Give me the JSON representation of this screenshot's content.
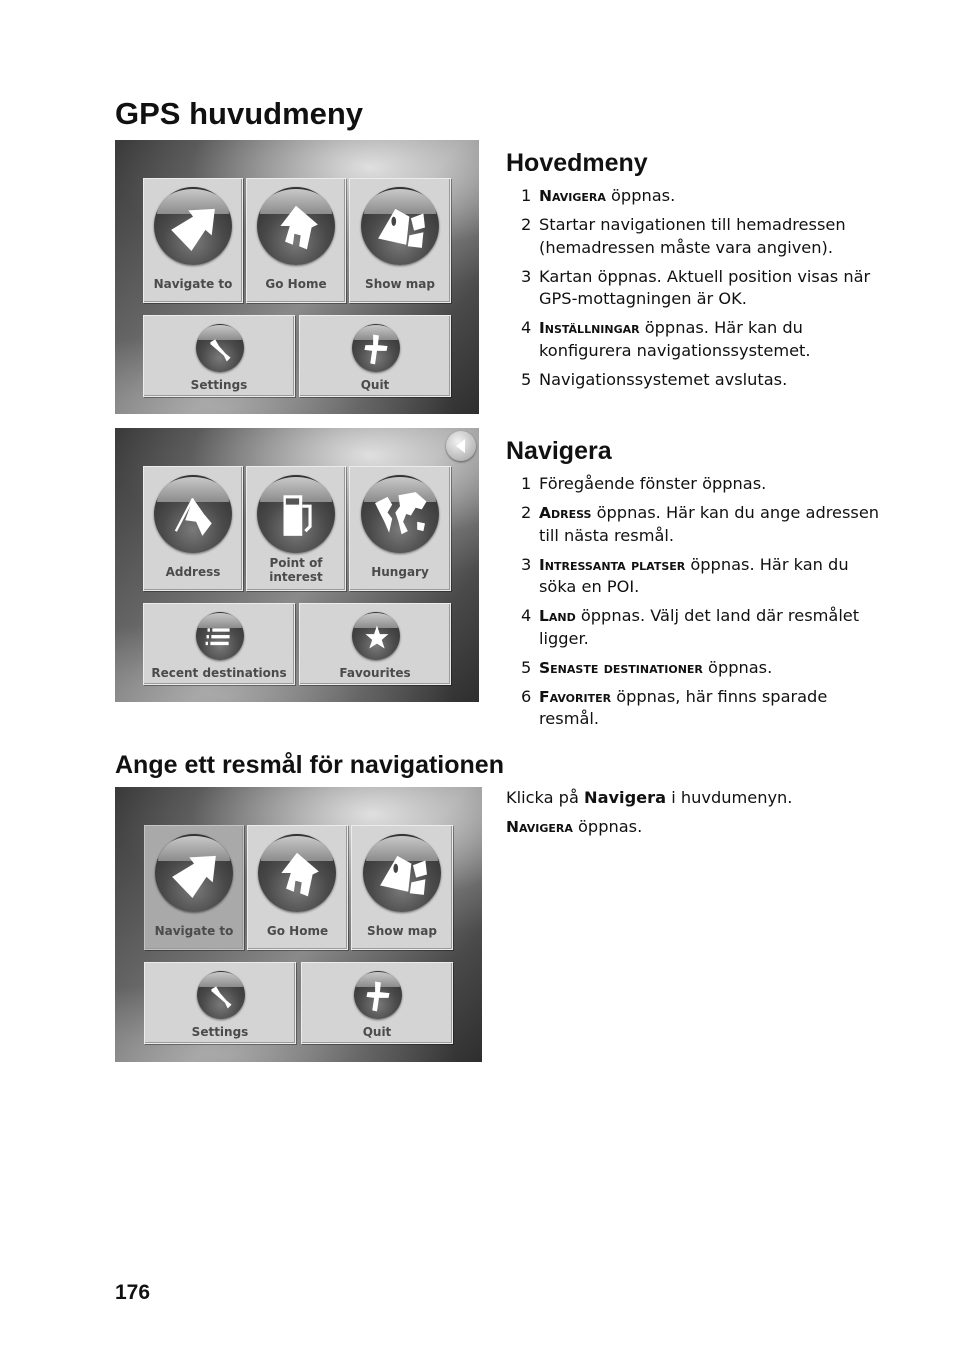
{
  "page": {
    "title": "GPS huvudmeny",
    "page_number": "176"
  },
  "sections": {
    "hovedmeny": {
      "heading": "Hovedmeny",
      "steps": [
        {
          "num": "1",
          "term": "Navigera",
          "text": " öppnas."
        },
        {
          "num": "2",
          "term": "",
          "text": "Startar navigationen till hemadressen (hemadressen måste vara angiven)."
        },
        {
          "num": "3",
          "term": "",
          "text": "Kartan öppnas. Aktuell position visas när GPS-mottagningen är OK."
        },
        {
          "num": "4",
          "term": "Inställningar",
          "text": " öppnas. Här kan du konfigurera navigationssystemet."
        },
        {
          "num": "5",
          "term": "",
          "text": "Navigationssystemet avslutas."
        }
      ]
    },
    "navigera": {
      "heading": "Navigera",
      "steps": [
        {
          "num": "1",
          "term": "",
          "text": "Föregående fönster öppnas."
        },
        {
          "num": "2",
          "term": "Adress",
          "text": " öppnas. Här kan du ange adressen till nästa resmål."
        },
        {
          "num": "3",
          "term": "Intressanta platser",
          "text": " öppnas. Här kan du söka en POI."
        },
        {
          "num": "4",
          "term": "Land",
          "text": " öppnas. Välj det land där resmålet ligger."
        },
        {
          "num": "5",
          "term": "Senaste destinationer",
          "text": " öppnas."
        },
        {
          "num": "6",
          "term": "Favoriter",
          "text": " öppnas, här finns sparade resmål."
        }
      ]
    },
    "ange": {
      "heading": "Ange ett resmål för navigationen",
      "para1_pre": "Klicka på ",
      "para1_bold": "Navigera",
      "para1_post": " i huvdumenyn.",
      "para2_term": "Navigera",
      "para2_text": " öppnas."
    }
  },
  "screens": {
    "main_menu": {
      "tiles": [
        {
          "label": "Navigate to",
          "icon": "arrow-icon"
        },
        {
          "label": "Go Home",
          "icon": "house-icon"
        },
        {
          "label": "Show map",
          "icon": "map-icon"
        },
        {
          "label": "Settings",
          "icon": "wrench-icon"
        },
        {
          "label": "Quit",
          "icon": "cross-icon"
        }
      ]
    },
    "navigate_menu": {
      "back_icon": "back-arrow-icon",
      "tiles": [
        {
          "label": "Address",
          "icon": "flag-icon"
        },
        {
          "label": "Point of interest",
          "icon": "fuel-pump-icon"
        },
        {
          "label": "Hungary",
          "icon": "globe-icon"
        },
        {
          "label": "Recent destinations",
          "icon": "list-icon"
        },
        {
          "label": "Favourites",
          "icon": "star-icon"
        }
      ]
    },
    "main_menu_selected": {
      "selected": "Navigate to",
      "tiles": [
        {
          "label": "Navigate to",
          "icon": "arrow-icon"
        },
        {
          "label": "Go Home",
          "icon": "house-icon"
        },
        {
          "label": "Show map",
          "icon": "map-icon"
        },
        {
          "label": "Settings",
          "icon": "wrench-icon"
        },
        {
          "label": "Quit",
          "icon": "cross-icon"
        }
      ]
    }
  }
}
